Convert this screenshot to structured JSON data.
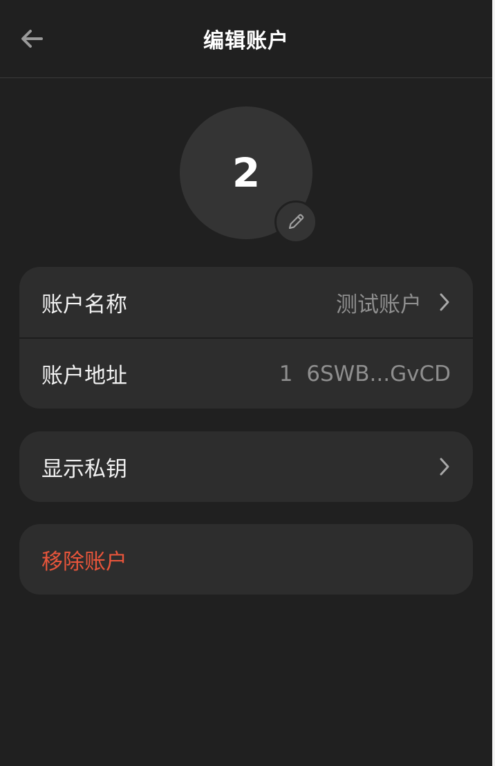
{
  "header": {
    "title": "编辑账户",
    "back_icon": "arrow-left-icon"
  },
  "avatar": {
    "text": "2",
    "edit_icon": "pencil-icon"
  },
  "account_card": {
    "name_label": "账户名称",
    "name_value": "测试账户",
    "address_label": "账户地址",
    "address_value": "1  6SWB...GvCD"
  },
  "private_key": {
    "label": "显示私钥"
  },
  "remove": {
    "label": "移除账户",
    "color": "#e8553b"
  },
  "colors": {
    "background": "#202020",
    "card": "#2d2d2d",
    "muted_text": "#8f8f8f"
  }
}
